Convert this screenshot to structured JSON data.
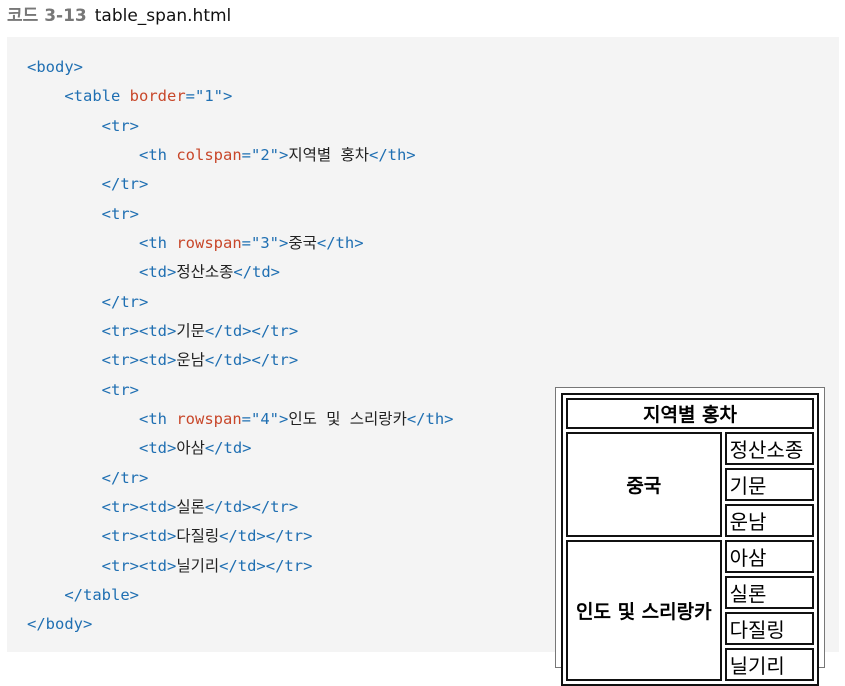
{
  "caption": {
    "number": "코드 3-13",
    "filename": "table_span.html"
  },
  "code": {
    "body_open": "<body>",
    "table_tag": "<table",
    "table_attr": "border",
    "table_val": "\"1\"",
    "tr_open": "<tr>",
    "tr_close": "</tr>",
    "th_tag": "<th",
    "th_close": "</th>",
    "td_open": "<td>",
    "td_close": "</td>",
    "gt": ">",
    "eq": "=",
    "colspan_attr": "colspan",
    "colspan_val": "\"2\"",
    "rowspan_attr": "rowspan",
    "rowspan_val_china": "\"3\"",
    "rowspan_val_india": "\"4\"",
    "table_close": "</table>",
    "body_close": "</body>"
  },
  "table": {
    "header": "지역별 홍차",
    "groups": [
      {
        "region": "중국",
        "teas": [
          "정산소종",
          "기문",
          "운남"
        ]
      },
      {
        "region": "인도 및 스리랑카",
        "teas": [
          "아삼",
          "실론",
          "다질링",
          "닐기리"
        ]
      }
    ]
  }
}
